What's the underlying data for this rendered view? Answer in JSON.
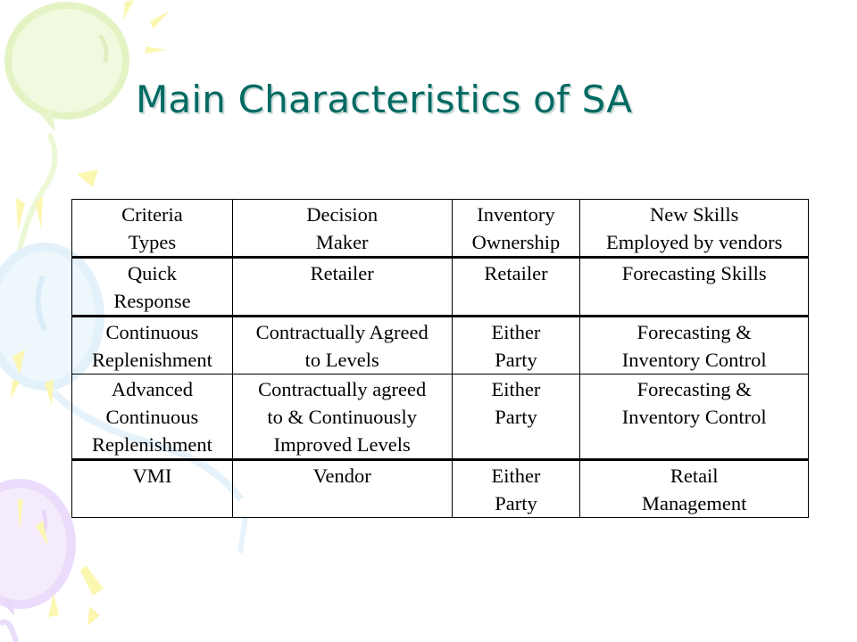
{
  "slide": {
    "title": "Main Characteristics of SA",
    "title_color": "#006a63"
  },
  "table": {
    "headers": [
      "Criteria\nTypes",
      "Decision\nMaker",
      "Inventory\nOwnership",
      "New Skills\nEmployed by vendors"
    ],
    "rows": [
      [
        "Quick\nResponse",
        "Retailer",
        "Retailer",
        "Forecasting Skills"
      ],
      [
        "Continuous\nReplenishment",
        "Contractually Agreed\nto Levels",
        "Either\nParty",
        "Forecasting &\nInventory Control"
      ],
      [
        "Advanced\nContinuous\nReplenishment",
        "Contractually agreed\nto & Continuously\nImproved Levels",
        "Either\nParty",
        "Forecasting &\nInventory Control"
      ],
      [
        "VMI",
        "Vendor",
        "Either\nParty",
        "Retail\nManagement"
      ]
    ]
  },
  "decorations": {
    "icons": [
      "balloon-icon",
      "confetti-icon"
    ],
    "balloon_colors": [
      "#eef8d8",
      "#e6f3fb",
      "#efe4fb"
    ],
    "confetti_color": "#fbf6a6"
  }
}
